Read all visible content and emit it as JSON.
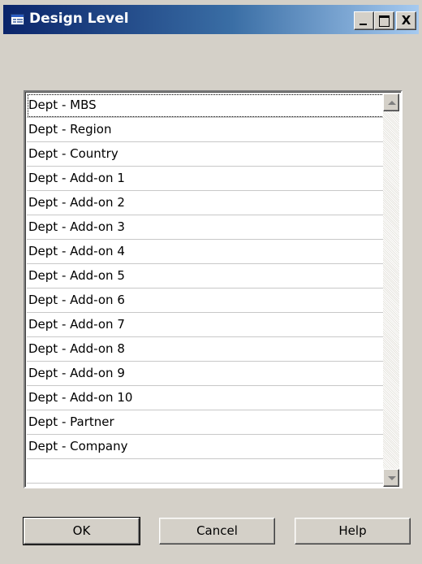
{
  "window": {
    "title": "Design Level"
  },
  "titlebar_buttons": {
    "minimize_icon": "minimize-icon",
    "maximize_icon": "maximize-icon",
    "close_icon": "close-icon",
    "close_glyph": "X"
  },
  "list": {
    "items": [
      "Dept - MBS",
      "Dept - Region",
      "Dept - Country",
      "Dept - Add-on 1",
      "Dept - Add-on 2",
      "Dept - Add-on 3",
      "Dept - Add-on 4",
      "Dept - Add-on 5",
      "Dept - Add-on 6",
      "Dept - Add-on 7",
      "Dept - Add-on 8",
      "Dept - Add-on 9",
      "Dept - Add-on 10",
      "Dept - Partner",
      "Dept - Company"
    ],
    "focused_index": 0
  },
  "buttons": {
    "ok": "OK",
    "cancel": "Cancel",
    "help": "Help"
  },
  "colors": {
    "titlebar_start": "#0a246a",
    "titlebar_end": "#a6caf0",
    "dialog_background": "#d4d0c8"
  }
}
